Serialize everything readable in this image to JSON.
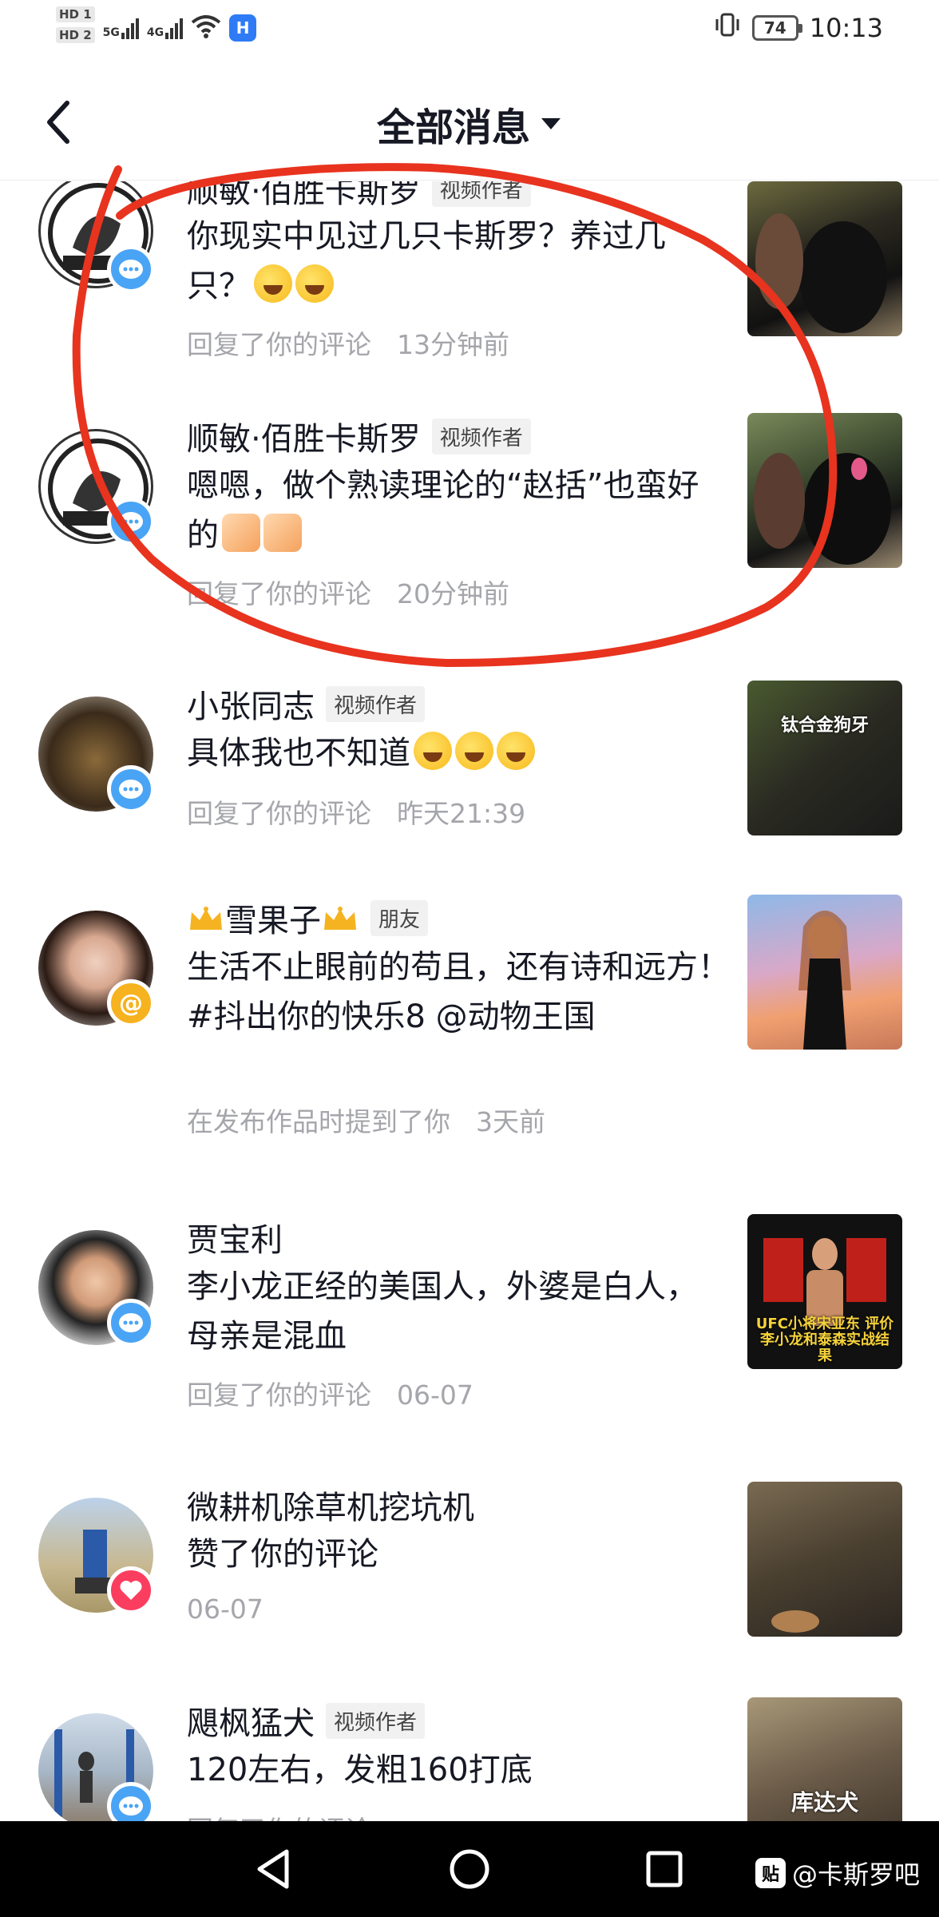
{
  "status_bar": {
    "hd1": "HD 1",
    "hd2": "HD 2",
    "net1": "5G",
    "net2": "4G",
    "battery": "74",
    "time": "10:13"
  },
  "header": {
    "title": "全部消息"
  },
  "items": [
    {
      "name": "顺敏·佰胜卡斯罗",
      "tag": "视频作者",
      "text": "你现实中见过几只卡斯罗？养过几只？",
      "action": "回复了你的评论",
      "time": "13分钟前",
      "badge": "message"
    },
    {
      "name": "顺敏·佰胜卡斯罗",
      "tag": "视频作者",
      "text": "嗯嗯，做个熟读理论的“赵括”也蛮好的",
      "action": "回复了你的评论",
      "time": "20分钟前",
      "badge": "message"
    },
    {
      "name": "小张同志",
      "tag": "视频作者",
      "text": "具体我也不知道",
      "action": "回复了你的评论",
      "time": "昨天21:39",
      "thumb_caption": "钛合金狗牙",
      "badge": "message"
    },
    {
      "name": "雪果子",
      "tag": "朋友",
      "text": "生活不止眼前的苟且，还有诗和远方！#抖出你的快乐8 @动物王国",
      "action": "在发布作品时提到了你",
      "time": "3天前",
      "badge": "at"
    },
    {
      "name": "贾宝利",
      "tag": "",
      "text": "李小龙正经的美国人，外婆是白人，母亲是混血",
      "action": "回复了你的评论",
      "time": "06-07",
      "thumb_caption": "UFC小将宋亚东 评价李小龙和泰森实战结果",
      "badge": "message"
    },
    {
      "name": "微耕机除草机挖坑机",
      "tag": "",
      "text": "赞了你的评论",
      "action": "",
      "time": "06-07",
      "badge": "like"
    },
    {
      "name": "飓枫猛犬",
      "tag": "视频作者",
      "text": "120左右，发粗160打底",
      "action": "回复了你的评论",
      "time": "",
      "thumb_caption": "库达犬",
      "badge": "message"
    }
  ],
  "badge_at_symbol": "@",
  "watermark": "@卡斯罗吧",
  "colors": {
    "annotation": "#e8331f",
    "badge_message": "#4aa4f5",
    "badge_at": "#f6b21f",
    "badge_like": "#fb3e5f"
  }
}
